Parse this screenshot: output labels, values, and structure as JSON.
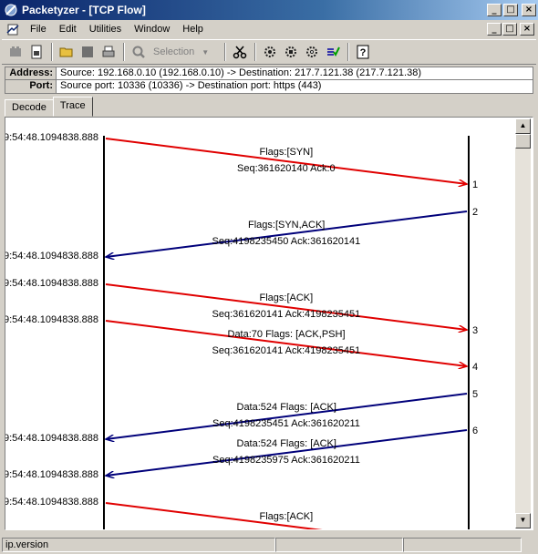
{
  "window": {
    "title": "Packetyzer - [TCP Flow]",
    "minimize": "_",
    "maximize": "□",
    "close": "×"
  },
  "menu": [
    "File",
    "Edit",
    "Utilities",
    "Window",
    "Help"
  ],
  "toolbar": {
    "selection_label": "Selection",
    "selection_arrow": "▼"
  },
  "info": {
    "address_label": "Address:",
    "address_value": "Source: 192.168.0.10 (192.168.0.10) -> Destination: 217.7.121.38 (217.7.121.38)",
    "port_label": "Port:",
    "port_value": "Source port: 10336 (10336) -> Destination port: https (443)"
  },
  "tabs": [
    "Decode",
    "Trace"
  ],
  "active_tab": "Trace",
  "trace": {
    "timestamps": [
      "9:54:48.1094838.888",
      "9:54:48.1094838.888",
      "9:54:48.1094838.888",
      "9:54:48.1094838.888",
      "9:54:48.1094838.888",
      "9:54:48.1094838.888",
      "9:54:48.1094838.888"
    ],
    "packets": [
      {
        "direction": "out",
        "label1": "Flags:[SYN]",
        "label2": "Seq:361620140  Ack:0",
        "num": "1"
      },
      {
        "direction": "in",
        "label1": "Flags:[SYN,ACK]",
        "label2": "Seq:4198235450  Ack:361620141",
        "num": "2"
      },
      {
        "direction": "out",
        "label1": "Flags:[ACK]",
        "label2": "Seq:361620141  Ack:4198235451",
        "num": "3"
      },
      {
        "direction": "out",
        "label1": "Data:70  Flags: [ACK,PSH]",
        "label2": "Seq:361620141  Ack:4198235451",
        "num": "4"
      },
      {
        "direction": "in",
        "label1": "Data:524  Flags: [ACK]",
        "label2": "Seq:4198235451  Ack:361620211",
        "num": "5"
      },
      {
        "direction": "in",
        "label1": "Data:524  Flags: [ACK]",
        "label2": "Seq:4198235975  Ack:361620211",
        "num": "6"
      },
      {
        "direction": "out",
        "label1": "Flags:[ACK]",
        "label2": "",
        "num": ""
      }
    ],
    "colors": {
      "out": "#e00000",
      "in": "#00007a"
    }
  },
  "status": {
    "text": "ip.version"
  }
}
